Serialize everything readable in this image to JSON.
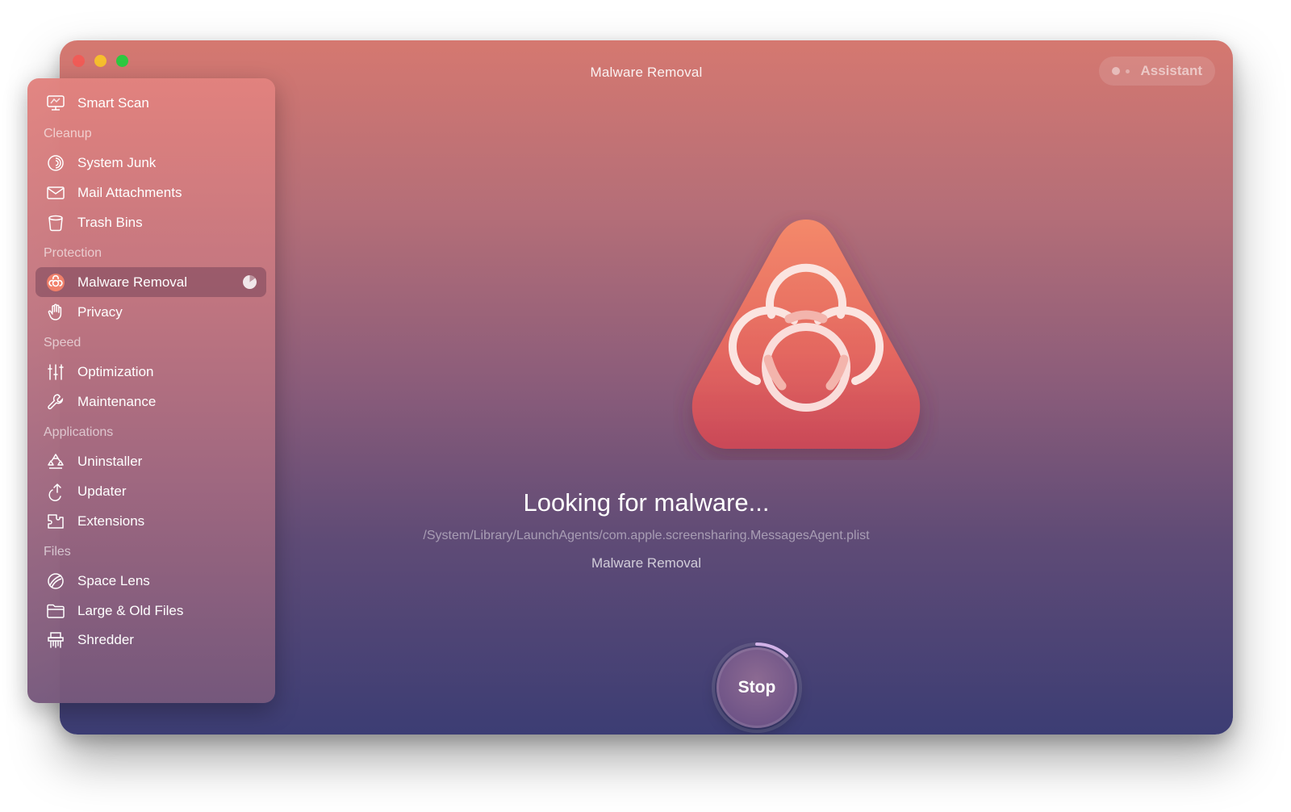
{
  "window": {
    "title": "Malware Removal"
  },
  "toolbar": {
    "assistant_label": "Assistant"
  },
  "sidebar": {
    "smart_scan": "Smart Scan",
    "sections": {
      "cleanup": "Cleanup",
      "protection": "Protection",
      "speed": "Speed",
      "applications": "Applications",
      "files": "Files"
    },
    "items": {
      "system_junk": "System Junk",
      "mail_attachments": "Mail Attachments",
      "trash_bins": "Trash Bins",
      "malware_removal": "Malware Removal",
      "privacy": "Privacy",
      "optimization": "Optimization",
      "maintenance": "Maintenance",
      "uninstaller": "Uninstaller",
      "updater": "Updater",
      "extensions": "Extensions",
      "space_lens": "Space Lens",
      "large_old_files": "Large & Old Files",
      "shredder": "Shredder"
    },
    "active_item": "malware_removal",
    "active_progress_percent": 15
  },
  "main": {
    "status": "Looking for malware...",
    "current_path": "/System/Library/LaunchAgents/com.apple.screensharing.MessagesAgent.plist",
    "module": "Malware Removal",
    "stop_label": "Stop",
    "scan_progress_fraction": 0.12
  },
  "colors": {
    "accent": "#f0806a",
    "traffic_red": "#f05c57",
    "traffic_yellow": "#f6be2e",
    "traffic_green": "#2dc840"
  },
  "icons": {
    "smart_scan": "monitor-icon",
    "system_junk": "swirl-icon",
    "mail_attachments": "envelope-icon",
    "trash_bins": "trash-icon",
    "malware_removal": "biohazard-icon",
    "privacy": "hand-icon",
    "optimization": "sliders-icon",
    "maintenance": "wrench-icon",
    "uninstaller": "uninstall-icon",
    "updater": "update-arrow-icon",
    "extensions": "puzzle-icon",
    "space_lens": "lens-icon",
    "large_old_files": "folder-icon",
    "shredder": "shredder-icon"
  }
}
